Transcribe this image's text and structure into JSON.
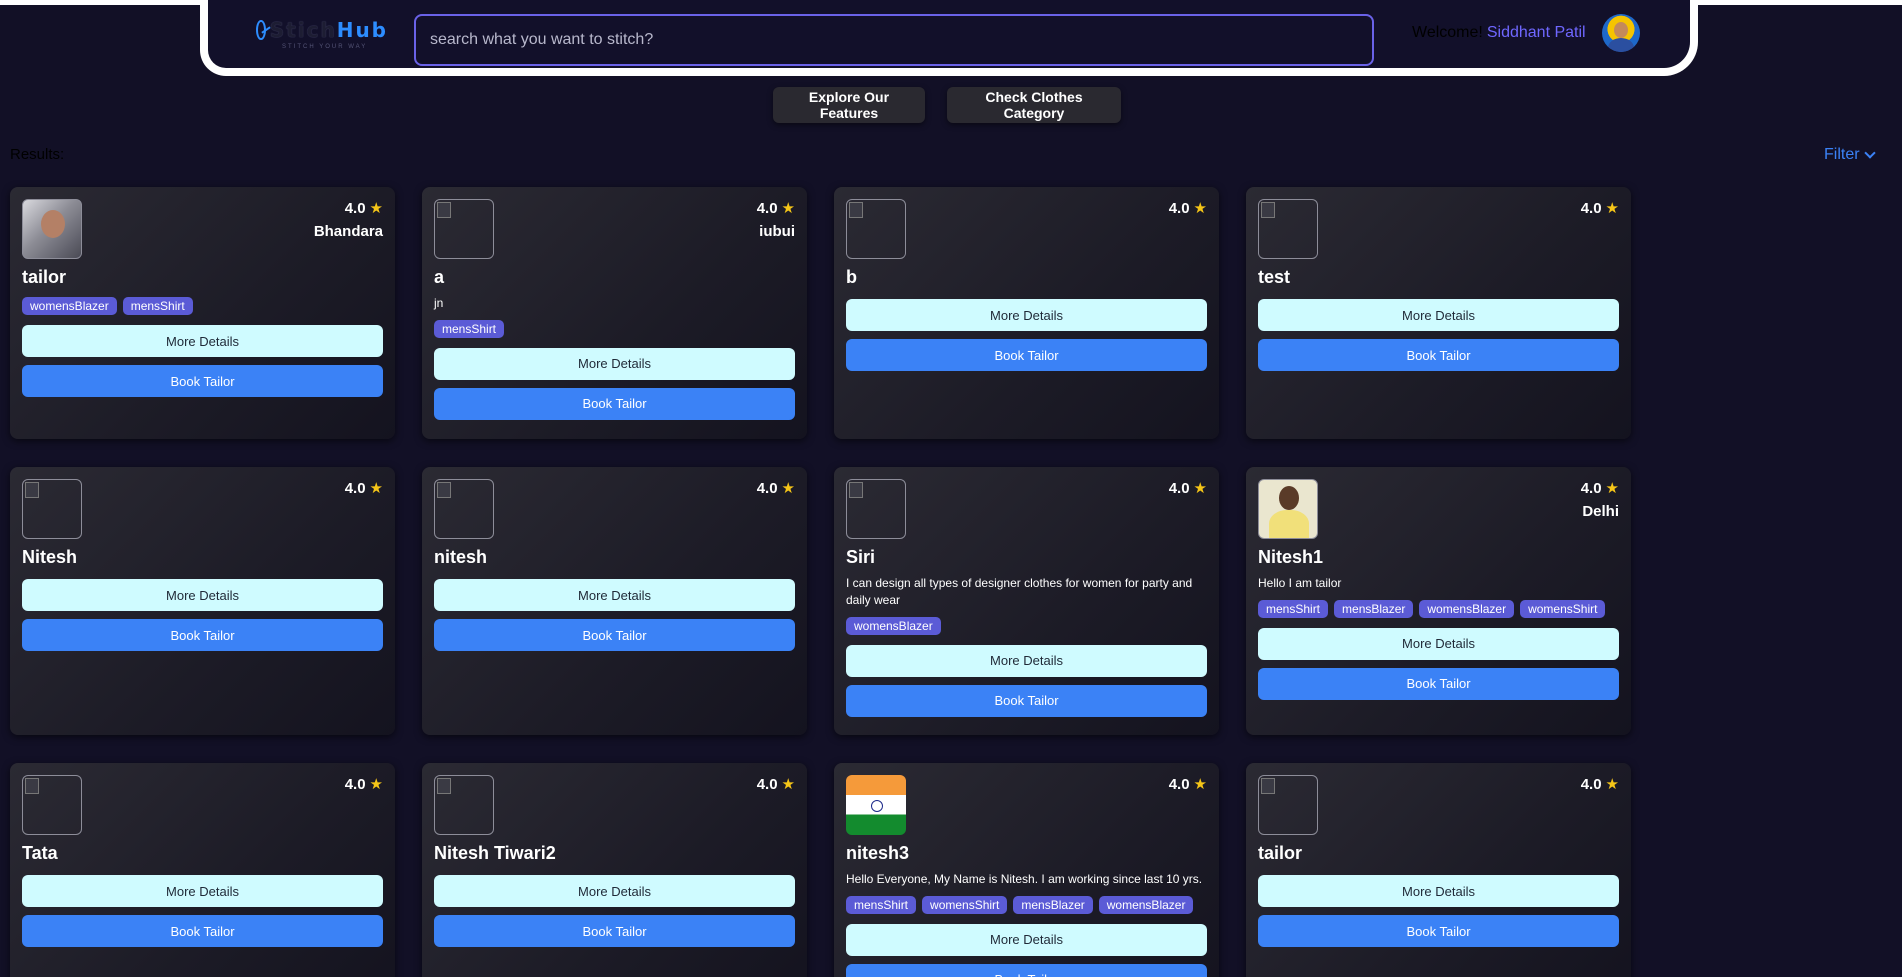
{
  "header": {
    "logo_stich": "Stich",
    "logo_hub": "Hub",
    "logo_tagline": "STITCH YOUR WAY",
    "search_placeholder": "search what you want to stitch?",
    "welcome_label": "Welcome!",
    "user_name": "Siddhant Patil"
  },
  "nav": {
    "explore_label": "Explore Our Features",
    "category_label": "Check Clothes Category"
  },
  "results": {
    "label": "Results:",
    "filter_label": "Filter"
  },
  "buttons": {
    "more_details": "More Details",
    "book_tailor": "Book Tailor"
  },
  "cards": [
    {
      "name": "tailor",
      "rating": "4.0",
      "location": "Bhandara",
      "description": "",
      "tags": [
        "womensBlazer",
        "mensShirt"
      ],
      "image": "photo-tailor"
    },
    {
      "name": "a",
      "rating": "4.0",
      "location": "iubui",
      "description": "jn",
      "tags": [
        "mensShirt"
      ],
      "image": "broken"
    },
    {
      "name": "b",
      "rating": "4.0",
      "location": "",
      "description": "",
      "tags": [],
      "image": "broken"
    },
    {
      "name": "test",
      "rating": "4.0",
      "location": "",
      "description": "",
      "tags": [],
      "image": "broken"
    },
    {
      "name": "Nitesh",
      "rating": "4.0",
      "location": "",
      "description": "",
      "tags": [],
      "image": "broken"
    },
    {
      "name": "nitesh",
      "rating": "4.0",
      "location": "",
      "description": "",
      "tags": [],
      "image": "broken"
    },
    {
      "name": "Siri",
      "rating": "4.0",
      "location": "",
      "description": "I can design all types of designer clothes for women for party and daily wear",
      "tags": [
        "womensBlazer"
      ],
      "image": "broken"
    },
    {
      "name": "Nitesh1",
      "rating": "4.0",
      "location": "Delhi",
      "description": "Hello I am tailor",
      "tags": [
        "mensShirt",
        "mensBlazer",
        "womensBlazer",
        "womensShirt"
      ],
      "image": "photo-nitesh1"
    },
    {
      "name": "Tata",
      "rating": "4.0",
      "location": "",
      "description": "",
      "tags": [],
      "image": "broken"
    },
    {
      "name": "Nitesh Tiwari2",
      "rating": "4.0",
      "location": "",
      "description": "",
      "tags": [],
      "image": "broken"
    },
    {
      "name": "nitesh3",
      "rating": "4.0",
      "location": "",
      "description": "Hello Everyone, My Name is Nitesh. I am working since last 10 yrs.",
      "tags": [
        "mensShirt",
        "womensShirt",
        "mensBlazer",
        "womensBlazer"
      ],
      "image": "flag"
    },
    {
      "name": "tailor",
      "rating": "4.0",
      "location": "",
      "description": "",
      "tags": [],
      "image": "broken"
    }
  ]
}
